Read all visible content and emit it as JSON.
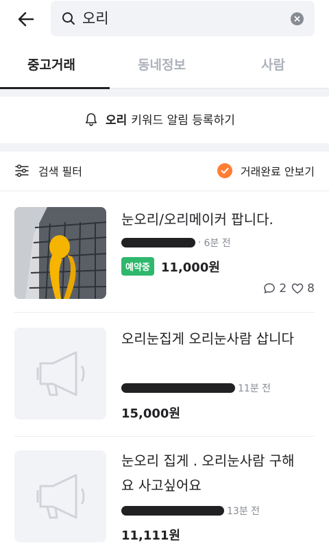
{
  "search": {
    "query": "오리"
  },
  "tabs": [
    {
      "label": "중고거래",
      "active": true
    },
    {
      "label": "동네정보",
      "active": false
    },
    {
      "label": "사람",
      "active": false
    }
  ],
  "keyword_alert": {
    "keyword": "오리",
    "text": "키워드 알림 등록하기"
  },
  "filter": {
    "label": "검색 필터",
    "hide_completed_label": "거래완료 안보기",
    "hide_completed_checked": true
  },
  "items": [
    {
      "title": "눈오리/오리메이커 팝니다.",
      "time": "6분 전",
      "badge": "예약중",
      "price": "11,000원",
      "chat_count": "2",
      "like_count": "8"
    },
    {
      "title": "오리눈집게 오리눈사람 삽니다",
      "time": "11분 전",
      "price": "15,000원"
    },
    {
      "title": "눈오리 집게 . 오리눈사람 구해요 사고싶어요",
      "time": "13분 전",
      "price": "11,111원"
    }
  ],
  "colors": {
    "accent": "#ff7e36",
    "badge_green": "#2fb86d",
    "text_primary": "#212124",
    "text_muted": "#868b94"
  }
}
